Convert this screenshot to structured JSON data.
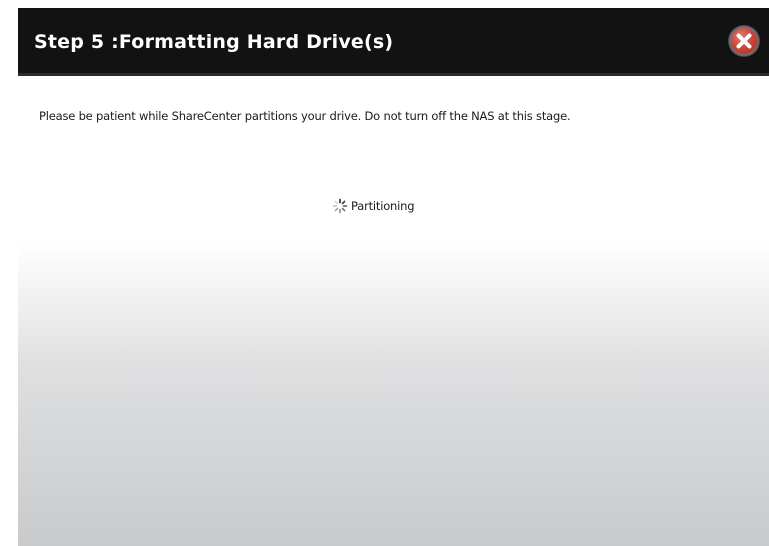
{
  "dialog": {
    "title": "Step 5 :Formatting Hard Drive(s)",
    "close_icon": "close-icon",
    "message": "Please be patient while ShareCenter partitions your drive. Do not turn off the NAS at this stage.",
    "status": {
      "icon": "loading-spinner-icon",
      "label": "Partitioning"
    }
  },
  "colors": {
    "titlebar": "#121212",
    "title_text": "#ffffff",
    "close_button": "#c94338",
    "body_top": "#ffffff",
    "body_bottom": "#c8cacc",
    "text": "#1a1a1a"
  }
}
